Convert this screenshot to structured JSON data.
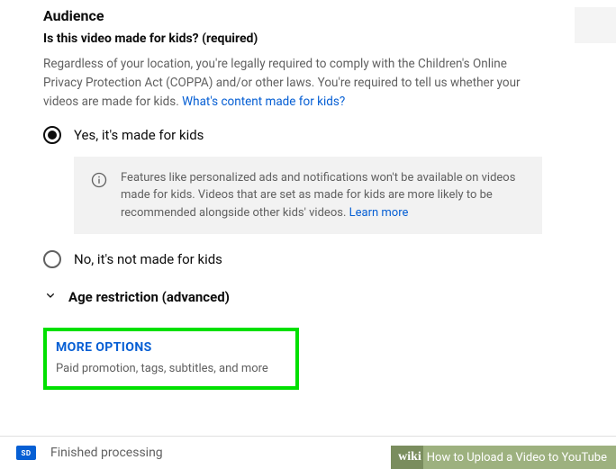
{
  "audience": {
    "title": "Audience",
    "question": "Is this video made for kids? (required)",
    "description": "Regardless of your location, you're legally required to comply with the Children's Online Privacy Protection Act (COPPA) and/or other laws. You're required to tell us whether your videos are made for kids. ",
    "description_link": "What's content made for kids?",
    "radio_yes": "Yes, it's made for kids",
    "radio_no": "No, it's not made for kids",
    "info_text": "Features like personalized ads and notifications won't be available on videos made for kids. Videos that are set as made for kids are more likely to be recommended alongside other kids' videos. ",
    "info_link": "Learn more",
    "age_restriction": "Age restriction (advanced)"
  },
  "more_options": {
    "label": "MORE OPTIONS",
    "sub": "Paid promotion, tags, subtitles, and more"
  },
  "footer": {
    "badge": "SD",
    "status": "Finished processing"
  },
  "banner": {
    "brand": "wiki",
    "title": "How to Upload a Video to YouTube"
  }
}
